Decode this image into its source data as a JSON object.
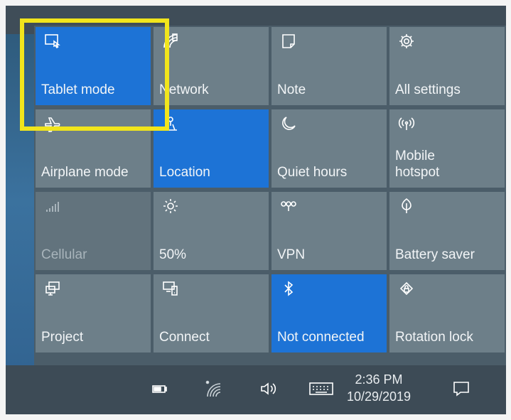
{
  "tiles": [
    {
      "label": "Tablet mode",
      "icon": "tablet-mode-icon",
      "state": "on"
    },
    {
      "label": "Network",
      "icon": "network-icon",
      "state": "off"
    },
    {
      "label": "Note",
      "icon": "note-icon",
      "state": "off"
    },
    {
      "label": "All settings",
      "icon": "gear-icon",
      "state": "off"
    },
    {
      "label": "Airplane mode",
      "icon": "airplane-icon",
      "state": "off"
    },
    {
      "label": "Location",
      "icon": "location-icon",
      "state": "on"
    },
    {
      "label": "Quiet hours",
      "icon": "moon-icon",
      "state": "off"
    },
    {
      "label": "Mobile\nhotspot",
      "icon": "hotspot-icon",
      "state": "off"
    },
    {
      "label": "Cellular",
      "icon": "cellular-signal-icon",
      "state": "disabled"
    },
    {
      "label": "50%",
      "icon": "brightness-icon",
      "state": "off"
    },
    {
      "label": "VPN",
      "icon": "vpn-icon",
      "state": "off"
    },
    {
      "label": "Battery saver",
      "icon": "battery-saver-icon",
      "state": "off"
    },
    {
      "label": "Project",
      "icon": "project-icon",
      "state": "off"
    },
    {
      "label": "Connect",
      "icon": "connect-icon",
      "state": "off"
    },
    {
      "label": "Not connected",
      "icon": "bluetooth-icon",
      "state": "on"
    },
    {
      "label": "Rotation lock",
      "icon": "rotation-lock-icon",
      "state": "off"
    }
  ],
  "taskbar": {
    "time": "2:36 PM",
    "date": "10/29/2019",
    "icons": [
      "battery-icon",
      "wifi-icon",
      "volume-icon",
      "keyboard-icon",
      "action-center-icon"
    ]
  },
  "colors": {
    "tile_on": "#1d73d6",
    "tile_off": "#6d7f89",
    "highlight": "#f1e51c",
    "taskbar": "#3d4b56"
  }
}
